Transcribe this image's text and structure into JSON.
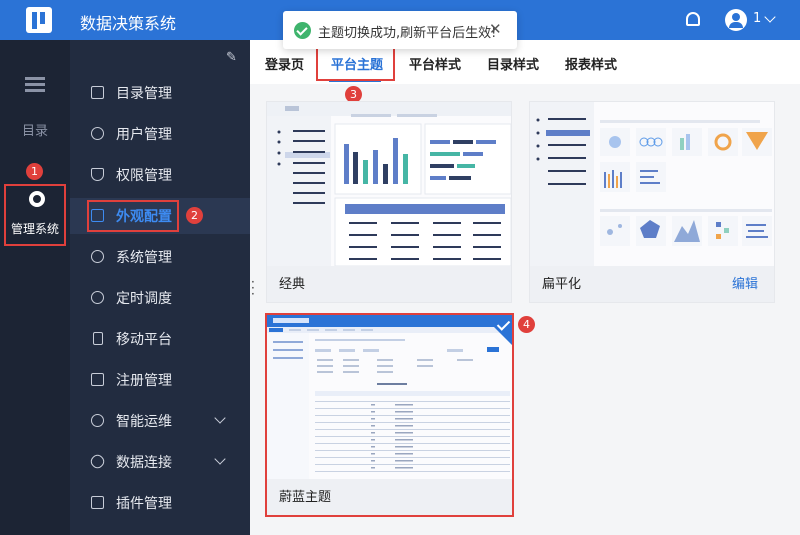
{
  "app": {
    "title": "数据决策系统",
    "user_count": "1"
  },
  "toast": {
    "message": "主题切换成功,刷新平台后生效!",
    "close": "✕"
  },
  "rail": {
    "catalog_label": "目录",
    "admin_label": "管理系统"
  },
  "menu": {
    "items": [
      {
        "label": "目录管理",
        "icon": "catalog-icon"
      },
      {
        "label": "用户管理",
        "icon": "user-icon"
      },
      {
        "label": "权限管理",
        "icon": "shield-icon"
      },
      {
        "label": "外观配置",
        "icon": "appearance-icon",
        "active": true
      },
      {
        "label": "系统管理",
        "icon": "gear-icon"
      },
      {
        "label": "定时调度",
        "icon": "timer-icon"
      },
      {
        "label": "移动平台",
        "icon": "mobile-icon"
      },
      {
        "label": "注册管理",
        "icon": "register-icon"
      },
      {
        "label": "智能运维",
        "icon": "ops-icon",
        "expandable": true
      },
      {
        "label": "数据连接",
        "icon": "link-icon",
        "expandable": true
      },
      {
        "label": "插件管理",
        "icon": "plugin-icon"
      }
    ]
  },
  "tabs": [
    {
      "label": "登录页"
    },
    {
      "label": "平台主题",
      "active": true
    },
    {
      "label": "平台样式"
    },
    {
      "label": "目录样式"
    },
    {
      "label": "报表样式"
    }
  ],
  "themes": [
    {
      "name": "经典",
      "edit": ""
    },
    {
      "name": "扁平化",
      "edit": "编辑"
    },
    {
      "name": "蔚蓝主题",
      "edit": "",
      "selected": true
    }
  ],
  "annotations": [
    "1",
    "2",
    "3",
    "4"
  ],
  "colors": {
    "accent": "#2b73d6",
    "highlight": "#e0403c",
    "success": "#3fb46d"
  }
}
